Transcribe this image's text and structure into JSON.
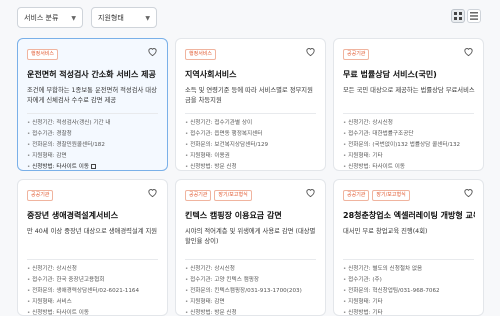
{
  "filters": {
    "service_category": "서비스 분류",
    "support_type": "지원형태"
  },
  "view_toggle": {
    "grid": "grid-view-icon",
    "list": "list-view-icon",
    "active": "grid"
  },
  "colors": {
    "badge": "#e0552b",
    "selected_border": "#7ab0e8"
  },
  "cards": [
    {
      "badges": [
        "행정서비스"
      ],
      "title": "운전면허 적성검사 간소화 서비스 제공",
      "desc": "조건에 부합하는 1종보통 운전면허 적성검사 대상자에게 신체검사 수수료 감면 제공",
      "info": [
        "신청기간: 적성검사(갱신) 기간 내",
        "접수기관: 경찰청",
        "전화문의: 경찰민원콜센터/182",
        "지원형태: 감면",
        "신청방법: 타사이트 이동"
      ]
    },
    {
      "badges": [
        "행정서비스"
      ],
      "title": "지역사회서비스",
      "desc": "소득 및 연령기준 등에 따라 서비스별로 정부지원금을 차등지원",
      "info": [
        "신청기간: 접수기관별 상이",
        "접수기관: 읍면동 행정복지센터",
        "전화문의: 보건복지상담센터/129",
        "지원형태: 이용권",
        "신청방법: 방문 신청"
      ]
    },
    {
      "badges": [
        "공공기관"
      ],
      "title": "무료 법률상담 서비스(국민)",
      "desc": "모든 국민 대상으로 제공하는 법률상담 무료서비스",
      "info": [
        "신청기간: 상시신청",
        "접수기관: 대한법률구조공단",
        "전화문의: (국번없이)132 법률상담 콜센터/132",
        "지원형태: 기타",
        "신청방법: 타사이트 이동"
      ]
    },
    {
      "badges": [
        "공공기관"
      ],
      "title": "중장년 생애경력설계서비스",
      "desc": "만 40세 이상 중장년 대상으로 생애경력설계 지원",
      "info": [
        "신청기간: 상시신청",
        "접수기관: 한국 중장년고용협회",
        "전화문의: 생애경력상담센터/02-6021-1164",
        "지원형태: 서비스",
        "신청방법: 타사이트 이동"
      ]
    },
    {
      "badges": [
        "공공기관",
        "장기/보고형식"
      ],
      "title": "킨텍스 캠핑장 이용요금 감면",
      "desc": "시야의 적어계층 및 위생에게 사용료 감면 (대상별 할인율 상이)",
      "info": [
        "신청기간: 상시신청",
        "접수기관: 고양 킨텍스 캠핑장",
        "전화문의: 킨텍스캠핑장/031-913-1700(203)",
        "지원형태: 감면",
        "신청방법: 방문 신청"
      ]
    },
    {
      "badges": [
        "공공기관",
        "장기/보고형식"
      ],
      "title": "28청춘창업소 엑셀러레이팅 개방형 교육",
      "desc": "대서민 무료 창업교육 진행(4회)",
      "info": [
        "신청기간: 별도의 신청절차 없음",
        "접수기관: (주)",
        "전화문의: 혁신창업팀/031-968-7062",
        "지원형태: 기타",
        "신청방법: 기타"
      ]
    }
  ]
}
